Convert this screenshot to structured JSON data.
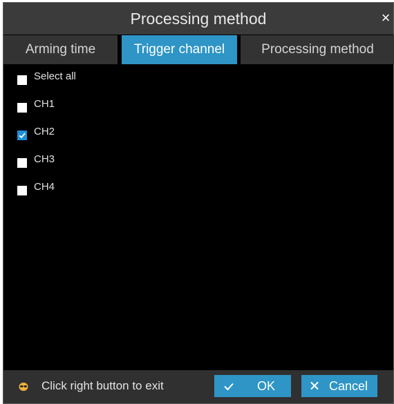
{
  "dialog": {
    "title": "Processing method",
    "close_glyph": "×"
  },
  "tabs": [
    {
      "label": "Arming time",
      "active": false
    },
    {
      "label": "Trigger channel",
      "active": true
    },
    {
      "label": "Processing method",
      "active": false
    }
  ],
  "channels": {
    "select_all_label": "Select all",
    "select_all_checked": false,
    "items": [
      {
        "label": "CH1",
        "checked": false
      },
      {
        "label": "CH2",
        "checked": true
      },
      {
        "label": "CH3",
        "checked": false
      },
      {
        "label": "CH4",
        "checked": false
      }
    ]
  },
  "footer": {
    "hint": "Click right button to exit",
    "hint_icon": "mouse-icon",
    "ok_label": "OK",
    "ok_icon": "checkmark-icon",
    "cancel_label": "Cancel",
    "cancel_icon": "close-icon"
  },
  "colors": {
    "accent": "#2e95c6",
    "checkbox_checked": "#1e90d9",
    "panel_bg": "#000000",
    "bar_bg": "#3b3b3b"
  }
}
